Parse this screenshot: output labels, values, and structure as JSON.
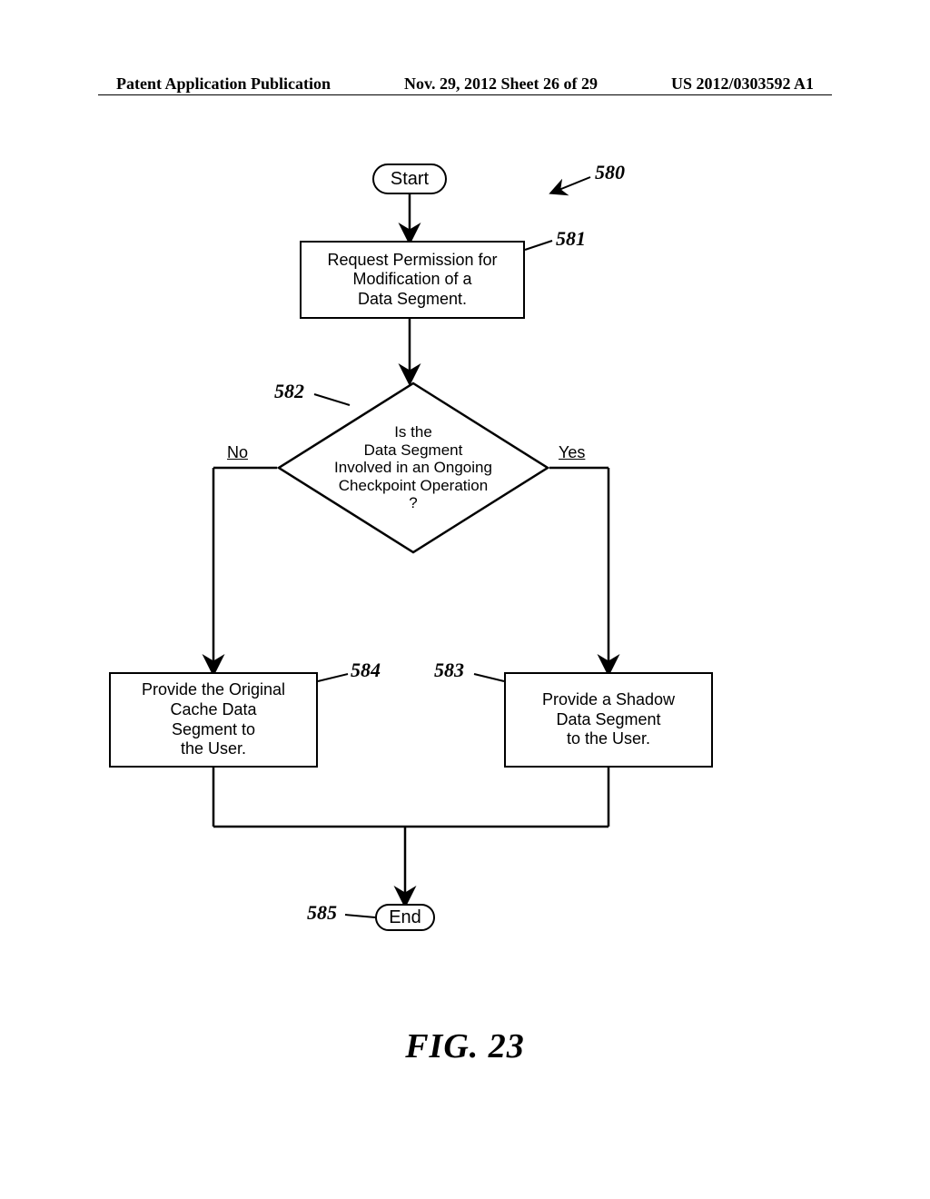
{
  "header": {
    "left": "Patent Application Publication",
    "center": "Nov. 29, 2012  Sheet 26 of 29",
    "right": "US 2012/0303592 A1"
  },
  "figure_label": "FIG.  23",
  "nodes": {
    "start": "Start",
    "end": "End",
    "b581": "Request Permission for\nModification of a\nData Segment.",
    "b582": "Is the\nData Segment\nInvolved in an Ongoing\nCheckpoint Operation\n?",
    "b583": "Provide a Shadow\nData Segment\nto the User.",
    "b584": "Provide the Original\nCache Data\nSegment to\nthe User."
  },
  "branches": {
    "no": "No",
    "yes": "Yes"
  },
  "refs": {
    "r580": "580",
    "r581": "581",
    "r582": "582",
    "r583": "583",
    "r584": "584",
    "r585": "585"
  },
  "chart_data": {
    "type": "flowchart",
    "title": "FIG. 23",
    "nodes": [
      {
        "id": "start",
        "kind": "terminator",
        "label": "Start"
      },
      {
        "id": "581",
        "kind": "process",
        "label": "Request Permission for Modification of a Data Segment."
      },
      {
        "id": "582",
        "kind": "decision",
        "label": "Is the Data Segment Involved in an Ongoing Checkpoint Operation?"
      },
      {
        "id": "583",
        "kind": "process",
        "label": "Provide a Shadow Data Segment to the User."
      },
      {
        "id": "584",
        "kind": "process",
        "label": "Provide the Original Cache Data Segment to the User."
      },
      {
        "id": "end",
        "kind": "terminator",
        "label": "End"
      }
    ],
    "edges": [
      {
        "from": "start",
        "to": "581"
      },
      {
        "from": "581",
        "to": "582"
      },
      {
        "from": "582",
        "to": "584",
        "label": "No"
      },
      {
        "from": "582",
        "to": "583",
        "label": "Yes"
      },
      {
        "from": "584",
        "to": "end"
      },
      {
        "from": "583",
        "to": "end"
      }
    ],
    "overall_ref": "580"
  }
}
